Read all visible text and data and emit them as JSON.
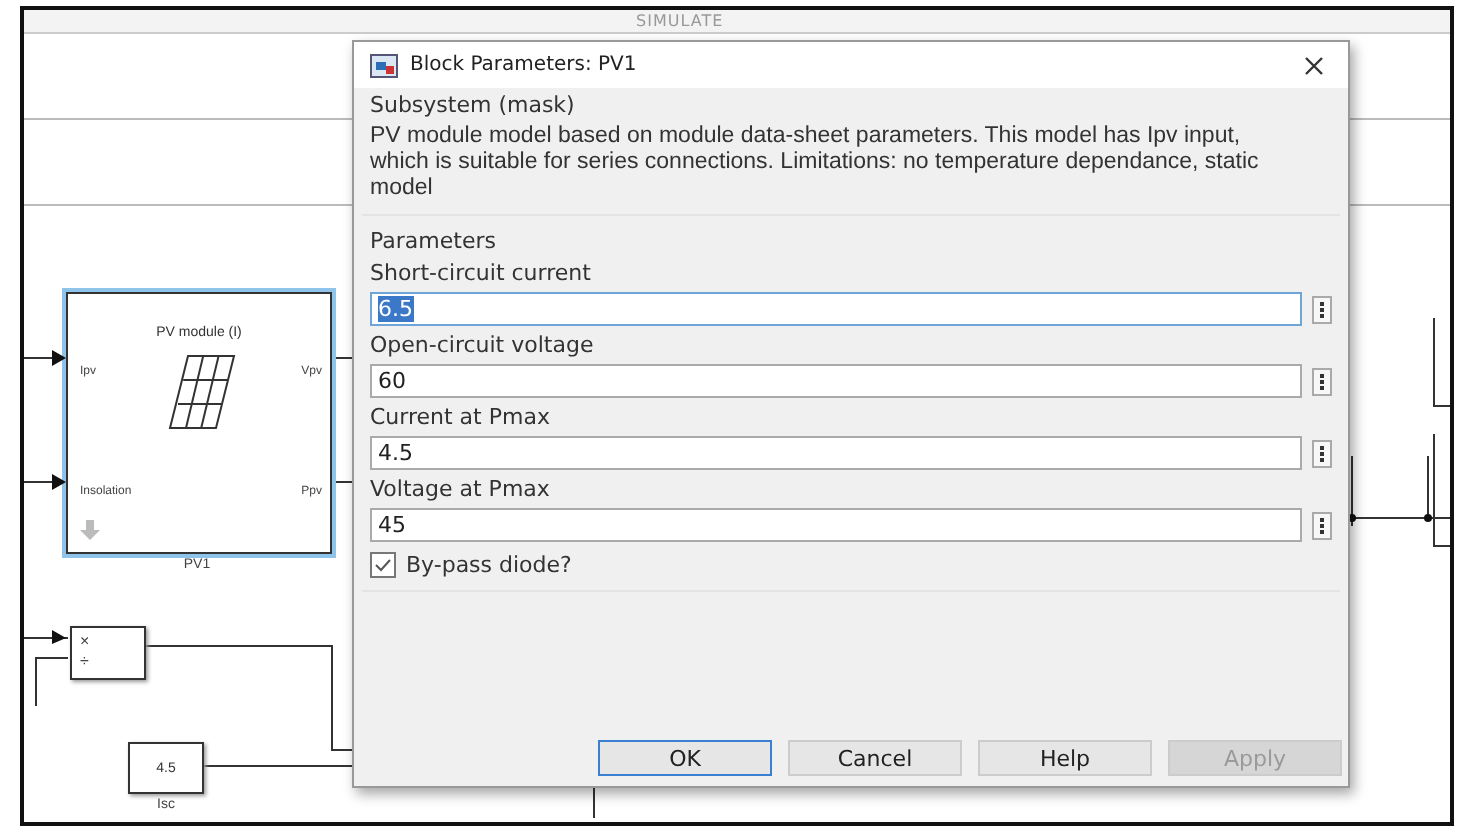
{
  "toolstrip": {
    "tab": "SIMULATE"
  },
  "canvas": {
    "blocks": [
      {
        "kind": "pv",
        "title": "PV module (I)",
        "inputs": [
          "Ipv",
          "Insolation"
        ],
        "outputs": [
          "Vpv",
          "Ppv"
        ],
        "name": "PV1",
        "selected": true
      },
      {
        "kind": "product",
        "inputs": [
          "×",
          "÷"
        ]
      },
      {
        "kind": "constant",
        "value": "4.5",
        "name": "Isc"
      }
    ]
  },
  "dialog": {
    "title": "Block Parameters: PV1",
    "section": "Subsystem (mask)",
    "description": "PV module model based on module data-sheet parameters. This model has Ipv input, which is suitable for series connections. Limitations: no temperature dependance, static model",
    "group": "Parameters",
    "parameters": [
      {
        "label": "Short-circuit current",
        "value": "6.5",
        "selected": true
      },
      {
        "label": "Open-circuit voltage",
        "value": "60",
        "selected": false
      },
      {
        "label": "Current at Pmax",
        "value": "4.5",
        "selected": false
      },
      {
        "label": "Voltage at Pmax",
        "value": "45",
        "selected": false
      }
    ],
    "checkbox": {
      "label": "By-pass diode?",
      "checked": true
    },
    "buttons": [
      {
        "label": "OK",
        "default": true,
        "disabled": false
      },
      {
        "label": "Cancel",
        "default": false,
        "disabled": false
      },
      {
        "label": "Help",
        "default": false,
        "disabled": false
      },
      {
        "label": "Apply",
        "default": false,
        "disabled": true
      }
    ]
  }
}
